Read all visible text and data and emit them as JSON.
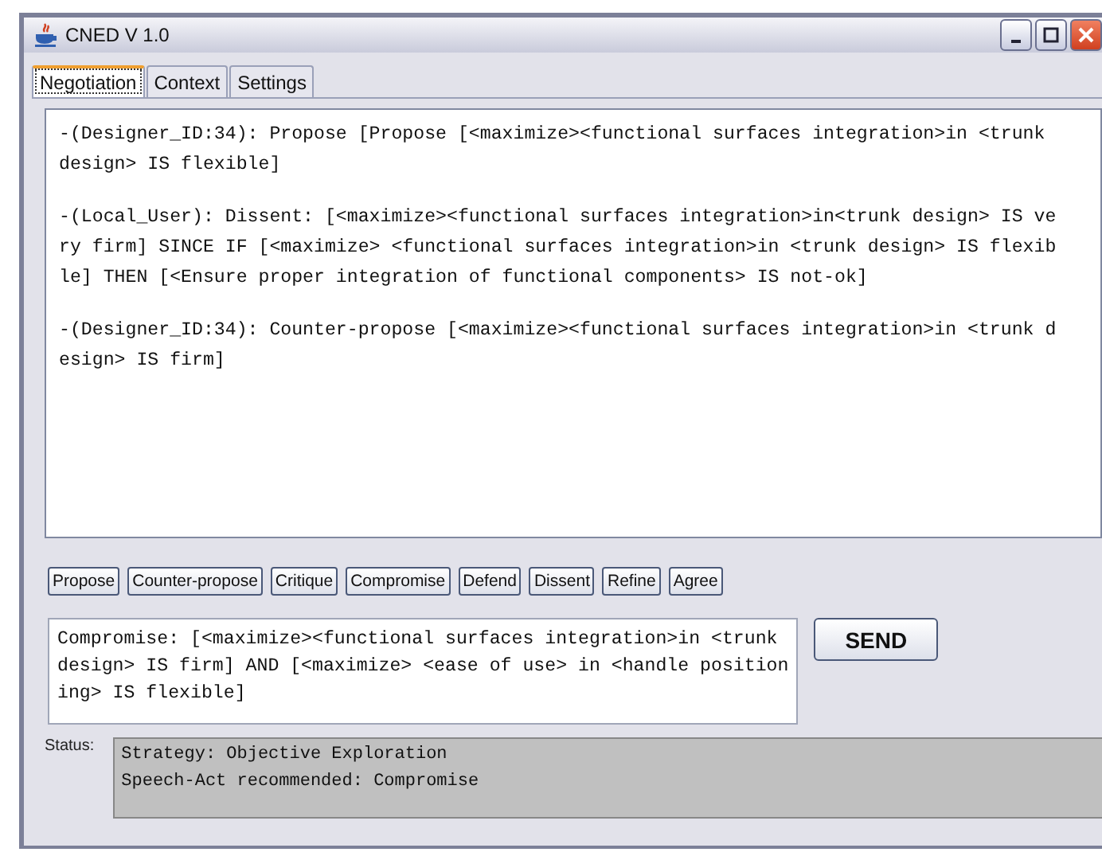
{
  "window": {
    "title": "CNED V 1.0"
  },
  "tabs": [
    {
      "label": "Negotiation",
      "selected": true
    },
    {
      "label": "Context",
      "selected": false
    },
    {
      "label": "Settings",
      "selected": false
    }
  ],
  "messages": [
    "-(Designer_ID:34): Propose [Propose [<maximize><functional surfaces integration>in <trunk design> IS flexible]",
    "-(Local_User): Dissent: [<maximize><functional surfaces integration>in<trunk design> IS very firm] SINCE IF [<maximize> <functional surfaces integration>in <trunk design> IS flexible] THEN [<Ensure proper integration of functional components> IS not-ok]",
    "-(Designer_ID:34): Counter-propose [<maximize><functional surfaces integration>in <trunk design> IS firm]"
  ],
  "speech_acts": [
    "Propose",
    "Counter-propose",
    "Critique",
    "Compromise",
    "Defend",
    "Dissent",
    "Refine",
    "Agree"
  ],
  "input": {
    "value": "Compromise: [<maximize><functional surfaces integration>in <trunk  design> IS firm] AND [<maximize> <ease of use> in <handle positioning> IS flexible]"
  },
  "send_button": "SEND",
  "status": {
    "label": "Status:",
    "lines": [
      "Strategy: Objective Exploration",
      "Speech-Act recommended: Compromise"
    ]
  }
}
